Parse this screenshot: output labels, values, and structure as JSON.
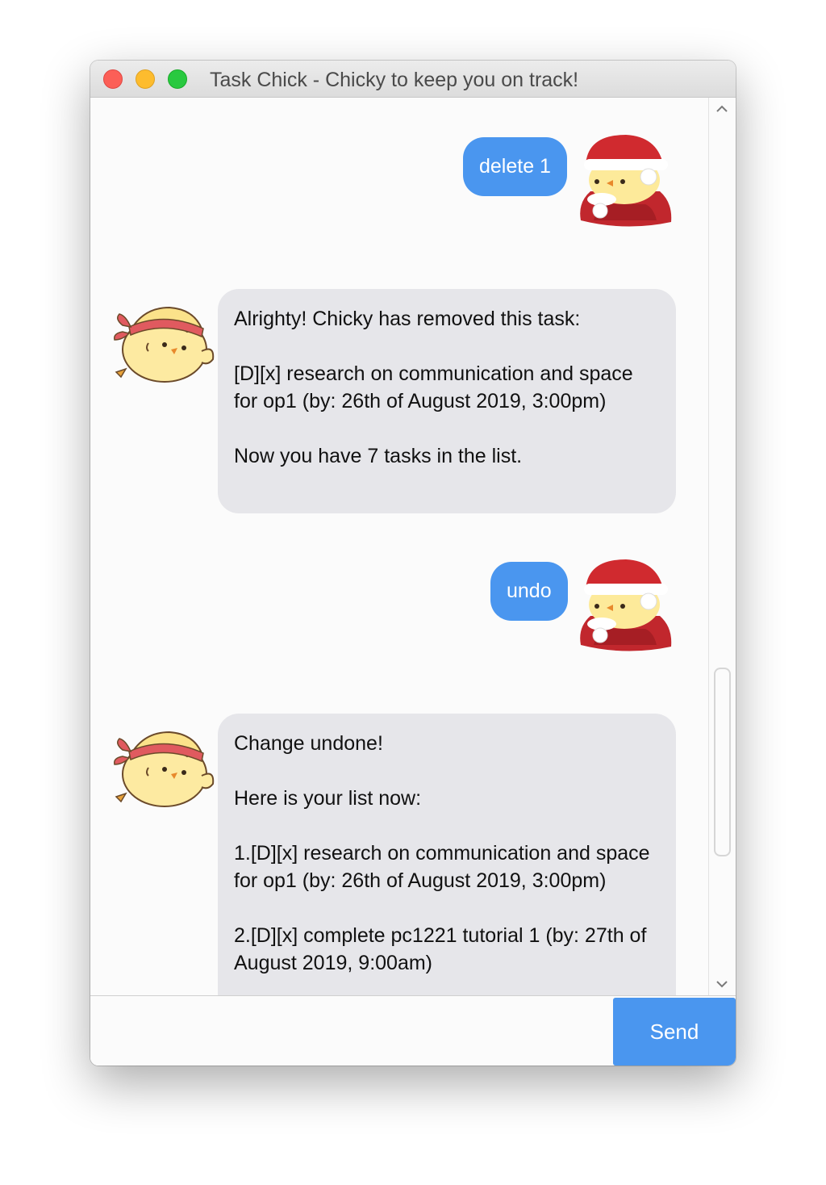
{
  "window": {
    "title": "Task Chick - Chicky to keep you on track!"
  },
  "messages": [
    {
      "from": "user",
      "text": "delete 1",
      "avatar": "santa-chick-icon"
    },
    {
      "from": "bot",
      "avatar": "chick-headband-icon",
      "paragraphs": [
        "Alrighty! Chicky has removed this task:",
        "[D][x] research on communication and space for op1 (by: 26th of August 2019, 3:00pm)",
        "Now you have 7 tasks in the list."
      ]
    },
    {
      "from": "user",
      "text": "undo",
      "avatar": "santa-chick-icon"
    },
    {
      "from": "bot",
      "avatar": "chick-headband-icon",
      "paragraphs": [
        "Change undone!",
        "Here is your list now:",
        "1.[D][x] research on communication and space for op1 (by: 26th of August 2019, 3:00pm)",
        "2.[D][x] complete pc1221 tutorial 1 (by: 27th of August 2019, 9:00am)"
      ]
    }
  ],
  "input": {
    "value": "",
    "placeholder": ""
  },
  "send_label": "Send",
  "colors": {
    "accent": "#4a96ef",
    "bot_bubble": "#e6e6ea"
  }
}
